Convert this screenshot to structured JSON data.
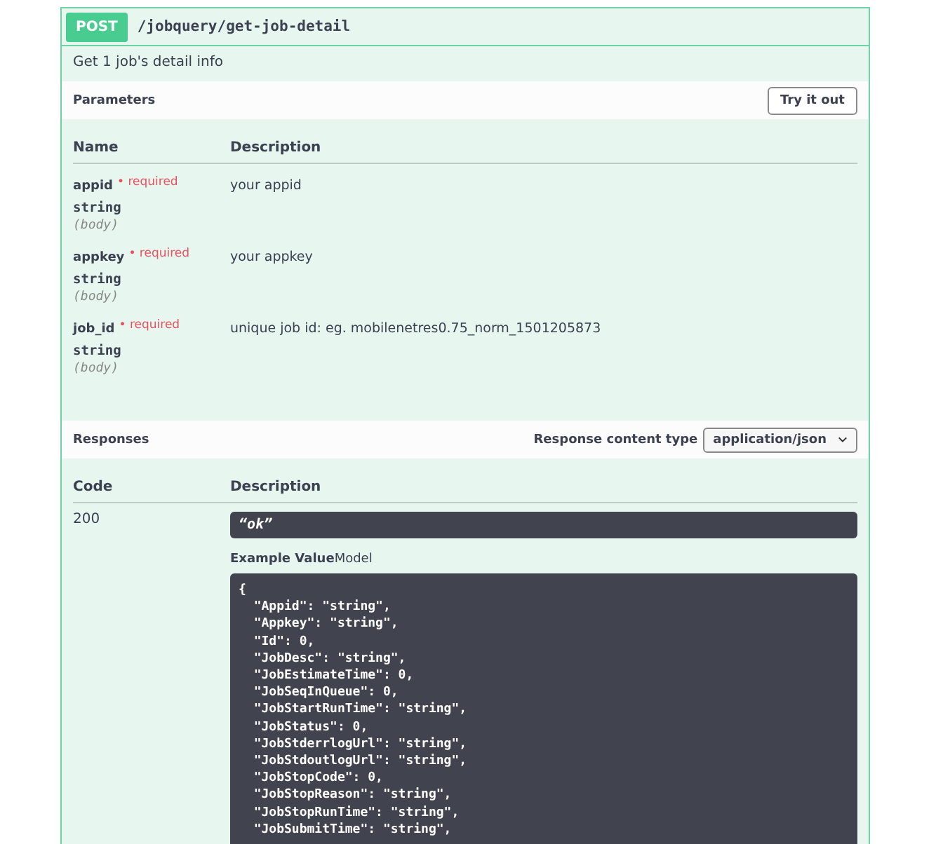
{
  "operation": {
    "method": "POST",
    "path": "/jobquery/get-job-detail",
    "summary": "Get 1 job's detail info"
  },
  "parameters": {
    "title": "Parameters",
    "try_button": "Try it out",
    "columns": [
      "Name",
      "Description"
    ],
    "rows": [
      {
        "name": "appid",
        "required_label": "• required",
        "type": "string",
        "location": "(body)",
        "description": "your appid"
      },
      {
        "name": "appkey",
        "required_label": "• required",
        "type": "string",
        "location": "(body)",
        "description": "your appkey"
      },
      {
        "name": "job_id",
        "required_label": "• required",
        "type": "string",
        "location": "(body)",
        "description": "unique job id: eg. mobilenetres0.75_norm_1501205873"
      }
    ]
  },
  "responses": {
    "title": "Responses",
    "content_type_label": "Response content type",
    "content_type": "application/json",
    "columns": [
      "Code",
      "Description"
    ],
    "rows": [
      {
        "code": "200",
        "description": "“ok”",
        "tabs": [
          {
            "label": "Example Value",
            "selected": true
          },
          {
            "label": "Model",
            "selected": false
          }
        ],
        "example_lines": [
          "{",
          "  \"Appid\": \"string\",",
          "  \"Appkey\": \"string\",",
          "  \"Id\": 0,",
          "  \"JobDesc\": \"string\",",
          "  \"JobEstimateTime\": 0,",
          "  \"JobSeqInQueue\": 0,",
          "  \"JobStartRunTime\": \"string\",",
          "  \"JobStatus\": 0,",
          "  \"JobStderrlogUrl\": \"string\",",
          "  \"JobStdoutlogUrl\": \"string\",",
          "  \"JobStopCode\": 0,",
          "  \"JobStopReason\": \"string\",",
          "  \"JobStopRunTime\": \"string\",",
          "  \"JobSubmitTime\": \"string\","
        ]
      }
    ]
  }
}
